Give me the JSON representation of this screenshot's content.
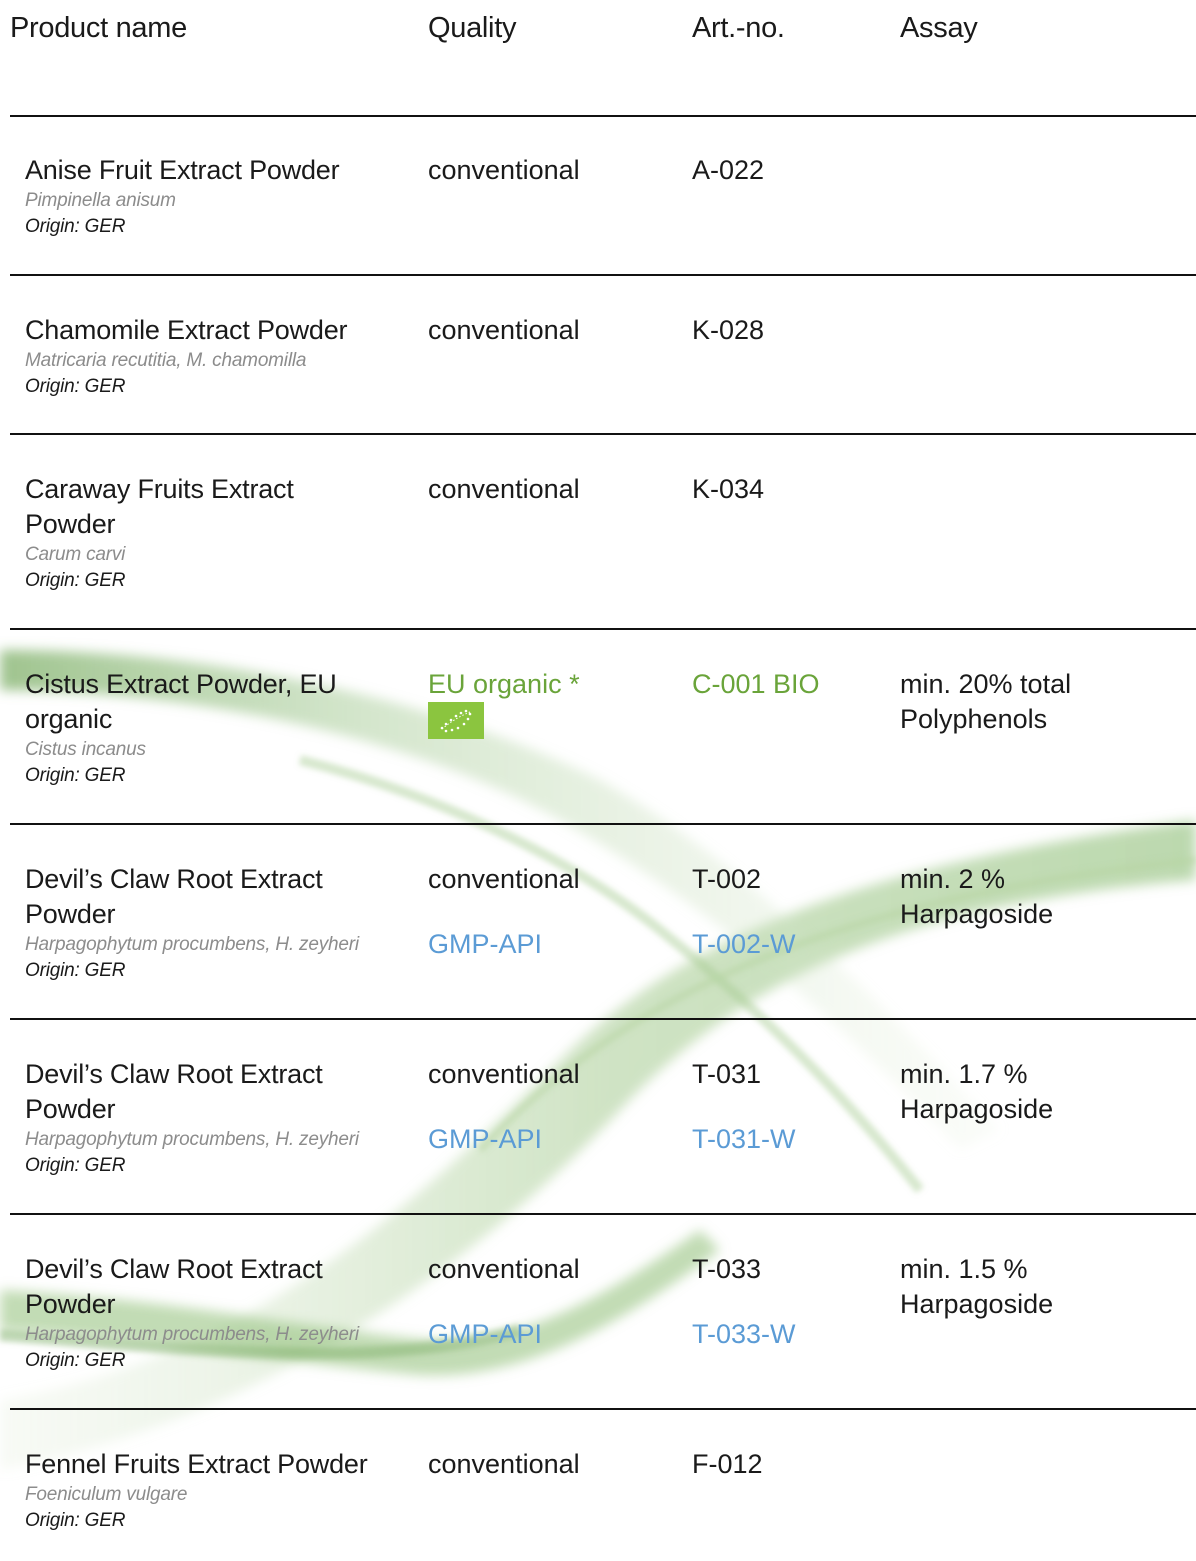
{
  "header": {
    "product": "Product name",
    "quality": "Quality",
    "art": "Art.-no.",
    "assay": "Assay"
  },
  "colors": {
    "gmp_link": "#5b9bd5",
    "organic_link": "#6aa43a",
    "eu_logo": "#8bc53f"
  },
  "rows": [
    {
      "name": "Anise Fruit Extract Powder",
      "latin": "Pimpinella anisum",
      "origin": "Origin: GER",
      "quality": "conventional",
      "art": "A-022"
    },
    {
      "name": "Chamomile Extract Powder",
      "latin": "Matricaria recutitia, M. chamomilla",
      "origin": "Origin: GER",
      "quality": "conventional",
      "art": "K-028"
    },
    {
      "name": "Caraway Fruits Extract Powder",
      "latin": "Carum carvi",
      "origin": "Origin: GER",
      "quality": "conventional",
      "art": "K-034"
    },
    {
      "name": "Cistus Extract Powder, EU organic",
      "latin": "Cistus incanus",
      "origin": "Origin: GER",
      "quality": "EU organic *",
      "quality_icon": "eu-organic-leaf-icon",
      "art": "C-001 BIO",
      "assay": "min. 20% total Polyphenols"
    },
    {
      "name": "Devil’s Claw Root Extract Powder",
      "latin": "Harpagophytum procumbens, H. zeyheri",
      "origin": "Origin: GER",
      "quality": "conventional",
      "quality2": "GMP-API",
      "art": "T-002",
      "art2": "T-002-W",
      "assay": "min. 2 % Harpagoside"
    },
    {
      "name": "Devil’s Claw Root Extract Powder",
      "latin": "Harpagophytum procumbens, H. zeyheri",
      "origin": "Origin: GER",
      "quality": "conventional",
      "quality2": "GMP-API",
      "art": "T-031",
      "art2": "T-031-W",
      "assay": "min. 1.7 % Harpagoside"
    },
    {
      "name": "Devil’s Claw Root Extract Powder",
      "latin": "Harpagophytum procumbens, H. zeyheri",
      "origin": "Origin: GER",
      "quality": "conventional",
      "quality2": "GMP-API",
      "art": "T-033",
      "art2": "T-033-W",
      "assay": "min. 1.5 % Harpagoside"
    },
    {
      "name": "Fennel Fruits Extract Powder",
      "latin": "Foeniculum vulgare",
      "origin": "Origin: GER",
      "quality": "conventional",
      "art": "F-012"
    }
  ]
}
